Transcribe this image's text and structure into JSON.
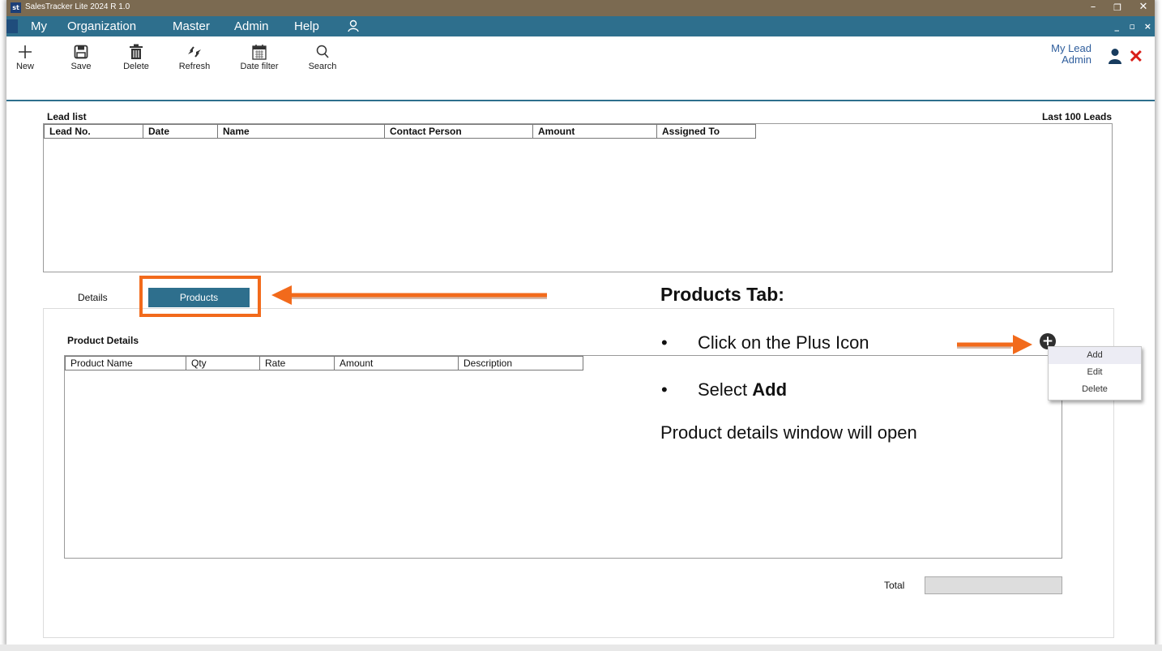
{
  "window": {
    "icon": "st",
    "title": "SalesTracker Lite 2024 R 1.0"
  },
  "menu": {
    "items": [
      "My",
      "Organization",
      "Master",
      "Admin",
      "Help"
    ]
  },
  "toolbar": {
    "new": "New",
    "save": "Save",
    "delete": "Delete",
    "refresh": "Refresh",
    "date_filter": "Date filter",
    "search": "Search",
    "screen_name": "My Lead",
    "user": "Admin"
  },
  "lead_list": {
    "title": "Lead list",
    "right_label": "Last 100 Leads",
    "columns": [
      "Lead No.",
      "Date",
      "Name",
      "Contact Person",
      "Amount",
      "Assigned To"
    ]
  },
  "tabs": {
    "details": "Details",
    "products": "Products"
  },
  "product_details": {
    "title": "Product Details",
    "columns": [
      "Product Name",
      "Qty",
      "Rate",
      "Amount",
      "Description"
    ]
  },
  "total": {
    "label": "Total"
  },
  "context_menu": {
    "items": [
      "Add",
      "Edit",
      "Delete"
    ]
  },
  "annotation": {
    "title": "Products Tab:",
    "bullet1": "Click on the Plus Icon",
    "bullet2_prefix": "Select ",
    "bullet2_bold": "Add",
    "note": "Product details window will open"
  },
  "colors": {
    "accent": "#2e6f8d",
    "titlebar": "#7b6a51",
    "highlight": "#f26a1b",
    "close": "#d91e18"
  }
}
